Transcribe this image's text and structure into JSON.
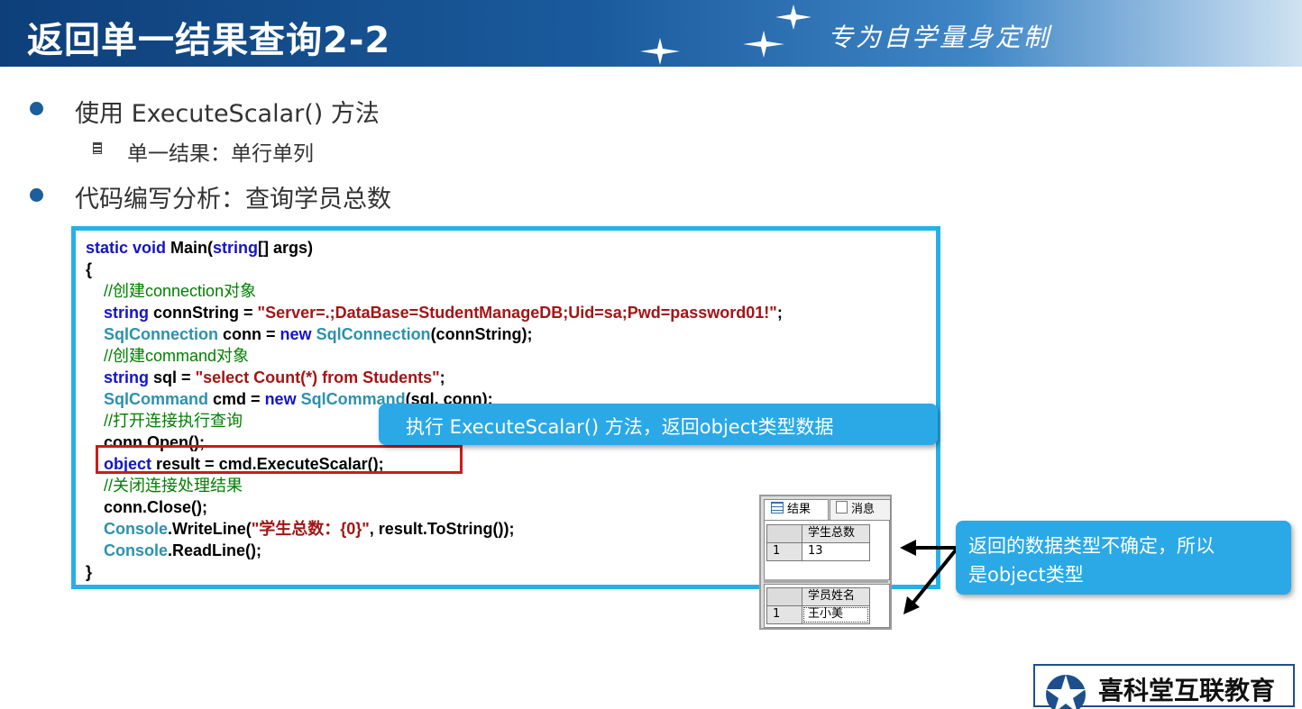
{
  "slide": {
    "title": "返回单一结果查询2-2",
    "slogan": "专为自学量身定制"
  },
  "bullets": [
    {
      "text": "使用 ExecuteScalar() 方法"
    },
    {
      "text": "单一结果：单行单列"
    },
    {
      "text": "代码编写分析：查询学员总数"
    }
  ],
  "code": {
    "l1a": "static void",
    "l1b": " Main(",
    "l1c": "string",
    "l1d": "[] args)",
    "l2": "{",
    "l3": "//创建connection对象",
    "l4a": "string",
    "l4b": " connString = ",
    "l4c": "\"Server=.;DataBase=StudentManageDB;Uid=sa;Pwd=password01!\"",
    "l4d": ";",
    "l5a": "SqlConnection",
    "l5b": " conn = ",
    "l5c": "new",
    "l5d": " ",
    "l5e": "SqlConnection",
    "l5f": "(connString);",
    "l6": "//创建command对象",
    "l7a": "string",
    "l7b": " sql = ",
    "l7c": "\"select Count(*) from Students\"",
    "l7d": ";",
    "l8a": "SqlCommand",
    "l8b": " cmd = ",
    "l8c": "new",
    "l8d": " ",
    "l8e": "SqlCommand",
    "l8f": "(sql, conn);",
    "l9": "//打开连接执行查询",
    "l10": "conn.Open();",
    "l11a": "object",
    "l11b": " result = cmd.ExecuteScalar();",
    "l12": "//关闭连接处理结果",
    "l13": "conn.Close();",
    "l14a": "Console",
    "l14b": ".WriteLine(",
    "l14c": "\"学生总数：{0}\"",
    "l14d": ", result.ToString());",
    "l15a": "Console",
    "l15b": ".ReadLine();",
    "l16": "}"
  },
  "callouts": {
    "execute": "执行 ExecuteScalar() 方法，返回object类型数据",
    "return_line1": "返回的数据类型不确定，所以",
    "return_line2": "是object类型"
  },
  "results_grid": {
    "tab_results": "结果",
    "tab_messages": "消息",
    "table1": {
      "header": "学生总数",
      "row_num": "1",
      "value": "13"
    },
    "table2": {
      "header": "学员姓名",
      "row_num": "1",
      "value": "王小美"
    }
  },
  "logo": {
    "text": "喜科堂互联教育"
  },
  "colors": {
    "accent": "#26b0e8",
    "keyword": "#1414c8",
    "type": "#2b91af",
    "string": "#a31515",
    "comment": "#008000",
    "highlight": "#d01a1a"
  }
}
